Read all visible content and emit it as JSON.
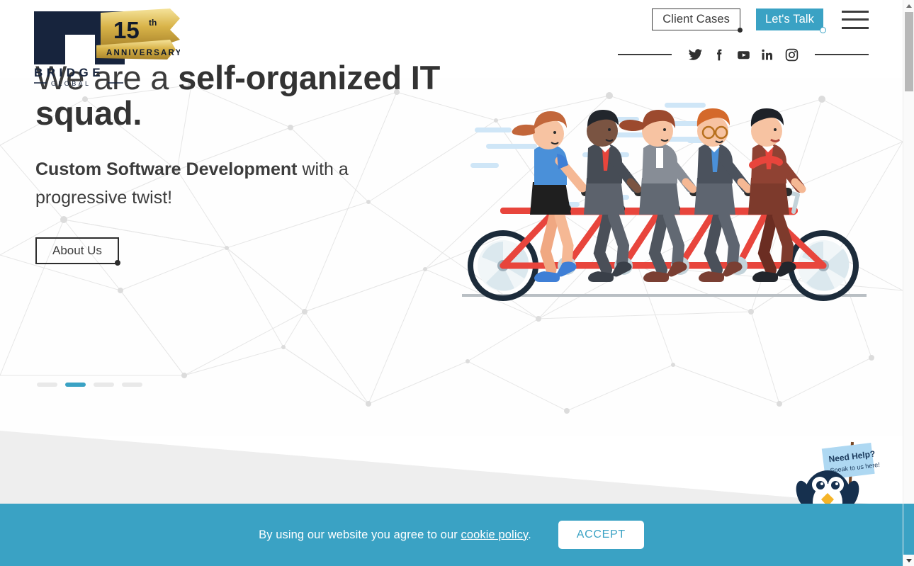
{
  "brand": {
    "name": "BRIDGE",
    "subname": "GLOBAL",
    "anniversary_number": "15",
    "anniversary_ordinal": "th",
    "anniversary_label": "ANNIVERSARY",
    "logo_dark": "#17243d",
    "anniversary_gold": "#c9a227"
  },
  "header": {
    "client_cases_label": "Client Cases",
    "lets_talk_label": "Let's Talk",
    "menu_label": "Menu",
    "accent_color": "#3aa2c4",
    "social": [
      {
        "name": "twitter",
        "label": "Twitter"
      },
      {
        "name": "facebook",
        "label": "Facebook"
      },
      {
        "name": "youtube",
        "label": "YouTube"
      },
      {
        "name": "linkedin",
        "label": "LinkedIn"
      },
      {
        "name": "instagram",
        "label": "Instagram"
      }
    ]
  },
  "hero": {
    "headline_light_1": "We are a ",
    "headline_bold": "self-organized IT squad.",
    "subline_bold": "Custom Software Development",
    "subline_rest": " with a progressive twist!",
    "cta_label": "About Us",
    "slides": [
      {
        "active": false
      },
      {
        "active": true
      },
      {
        "active": false
      },
      {
        "active": false
      }
    ]
  },
  "illustration": {
    "alt": "Five business people riding a red tandem bicycle",
    "frame_color": "#e8453c",
    "rider_count": 5
  },
  "chat_widget": {
    "title": "Need Help?",
    "subtitle": "Speak to us here!",
    "sign_color": "#aed8f2",
    "penguin_color": "#16304e"
  },
  "cookie": {
    "text_before": "By using our website you agree to our ",
    "link_label": "cookie policy",
    "text_after": ".",
    "accept_label": "ACCEPT",
    "bar_color": "#3aa2c4"
  },
  "scrollbar": {
    "up_label": "Scroll up",
    "down_label": "Scroll down"
  }
}
